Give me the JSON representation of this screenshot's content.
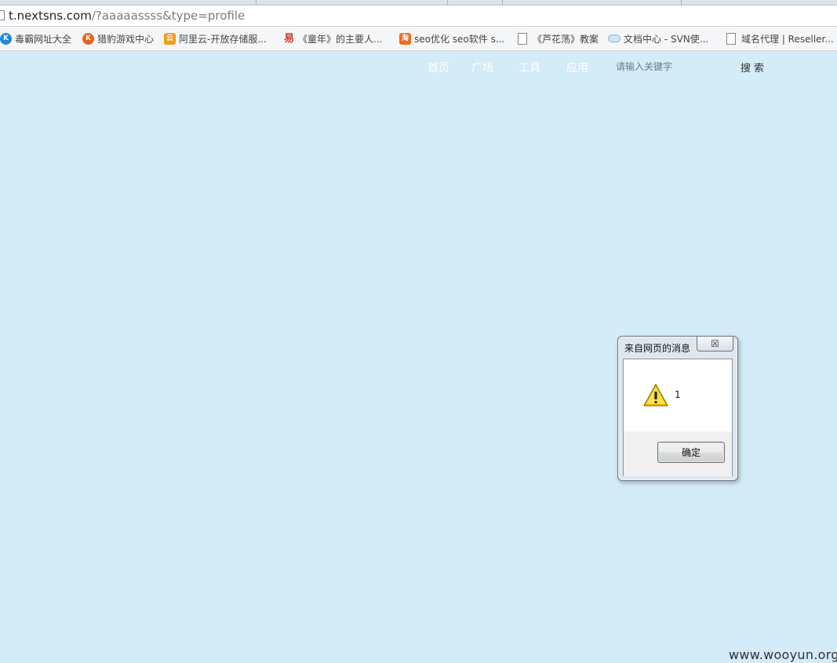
{
  "browser": {
    "url_host": "t.nextsns.com",
    "url_rest": "/?aaaaassss&type=profile"
  },
  "bookmarks": [
    {
      "label": "毒霸网址大全",
      "icon": "k-logo-icon",
      "color": "#1e88d9",
      "glyph": "K"
    },
    {
      "label": "猎豹游戏中心",
      "icon": "cheetah-logo-icon",
      "color": "#e8611f",
      "glyph": "K"
    },
    {
      "label": "阿里云-开放存储服...",
      "icon": "aliyun-logo-icon",
      "color": "#f39a1c",
      "glyph": "云"
    },
    {
      "label": "《童年》的主要人...",
      "icon": "yi-logo-icon",
      "color": "#d23a2b",
      "glyph": "易"
    },
    {
      "label": "seo优化 seo软件 s...",
      "icon": "taobao-logo-icon",
      "color": "#f06a23",
      "glyph": "淘"
    },
    {
      "label": "《芦花荡》教案",
      "icon": "page-icon",
      "color": "#ffffff",
      "glyph": ""
    },
    {
      "label": "文档中心 - SVN使...",
      "icon": "cloud-icon",
      "color": "#cfe6f7",
      "glyph": ""
    },
    {
      "label": "域名代理 | Reseller...",
      "icon": "page-icon",
      "color": "#ffffff",
      "glyph": ""
    }
  ],
  "nav": {
    "items": [
      "首页",
      "广场",
      "工具",
      "应用"
    ],
    "search_placeholder": "请输入关键字",
    "search_button": "搜索"
  },
  "dialog": {
    "title": "来自网页的消息",
    "close_glyph": "☒",
    "message": "1",
    "ok_label": "确定",
    "icon": "warning-icon"
  },
  "watermark": "www.wooyun.org",
  "colors": {
    "page_background": "#d4ebf8",
    "nav_text": "#ffffff"
  }
}
